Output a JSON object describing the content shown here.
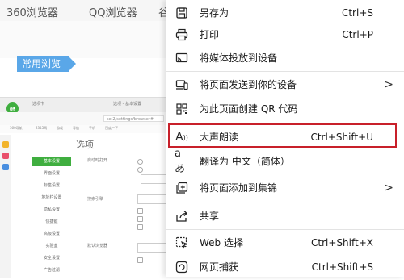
{
  "background": {
    "tabs": [
      "360浏览器",
      "QQ浏览器",
      "谷"
    ],
    "tag_label": "常用浏览",
    "screenshot": {
      "logo": "e",
      "tab1": "选项卡",
      "tab2": "选项 - 基本设置",
      "url": "se:2/settings/browser#",
      "bookmarks": [
        "360导航",
        "2345网",
        "游戏",
        "导航",
        "手机",
        "百度一下"
      ],
      "title": "选项",
      "nav": [
        "基本设置",
        "界面设置",
        "标签设置",
        "地址栏设置",
        "隐私设置",
        "快捷键",
        "高级设置",
        "实验室",
        "安全设置",
        "广告过滤"
      ],
      "labels": [
        "启动时打开",
        "搜索引擎",
        "默认浏览器"
      ]
    }
  },
  "menu": {
    "items": [
      {
        "icon": "save-icon",
        "label": "另存为",
        "shortcut": "Ctrl+S",
        "arrow": ""
      },
      {
        "icon": "print-icon",
        "label": "打印",
        "shortcut": "Ctrl+P",
        "arrow": ""
      },
      {
        "icon": "cast-icon",
        "label": "将媒体投放到设备",
        "shortcut": "",
        "arrow": ""
      },
      {
        "icon": "send-to-device-icon",
        "label": "将页面发送到你的设备",
        "shortcut": "",
        "arrow": ">"
      },
      {
        "icon": "qr-code-icon",
        "label": "为此页面创建 QR 代码",
        "shortcut": "",
        "arrow": ""
      },
      {
        "icon": "read-aloud-icon",
        "label": "大声朗读",
        "shortcut": "Ctrl+Shift+U",
        "arrow": ""
      },
      {
        "icon": "translate-icon",
        "label": "翻译为 中文（简体）",
        "shortcut": "",
        "arrow": ""
      },
      {
        "icon": "add-to-collection-icon",
        "label": "将页面添加到集锦",
        "shortcut": "",
        "arrow": ">"
      },
      {
        "icon": "share-icon",
        "label": "共享",
        "shortcut": "",
        "arrow": ""
      },
      {
        "icon": "web-select-icon",
        "label": "Web 选择",
        "shortcut": "Ctrl+Shift+X",
        "arrow": ""
      },
      {
        "icon": "web-capture-icon",
        "label": "网页捕获",
        "shortcut": "Ctrl+Shift+S",
        "arrow": ""
      }
    ],
    "highlight_color": "#c8202a"
  }
}
